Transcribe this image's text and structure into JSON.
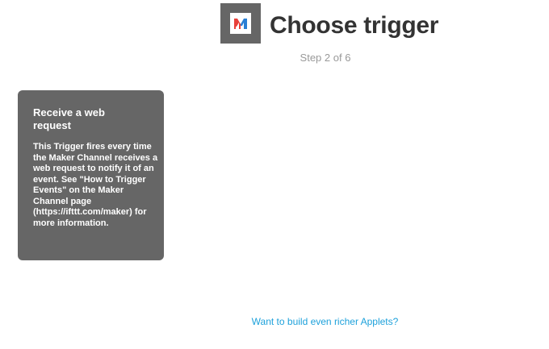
{
  "header": {
    "title": "Choose trigger",
    "step": "Step 2 of 6",
    "service_icon": "maker-channel-icon"
  },
  "trigger": {
    "title": "Receive a web request",
    "description": "This Trigger fires every time the Maker Channel receives a web request to notify it of an event. See \"How to Trigger Events\" on the Maker Channel page (https://ifttt.com/maker) for more information."
  },
  "footer": {
    "link_label": "Want to build even richer Applets?"
  },
  "colors": {
    "card_bg": "#666666",
    "link": "#1da1db",
    "title": "#333333",
    "step": "#999999",
    "logo_red": "#e8403a",
    "logo_blue": "#2a7fd4"
  }
}
